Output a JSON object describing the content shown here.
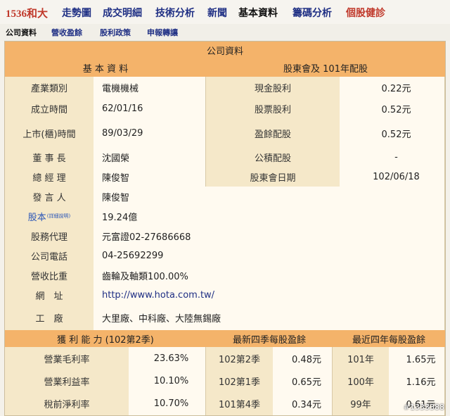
{
  "top_nav": {
    "stock_label": "1536和大",
    "items": [
      {
        "label": "走勢圖",
        "current": false,
        "color": "#1f2f84"
      },
      {
        "label": "成交明細",
        "current": false,
        "color": "#1f2f84"
      },
      {
        "label": "技術分析",
        "current": false,
        "color": "#1f2f84"
      },
      {
        "label": "新聞",
        "current": false,
        "color": "#1f2f84"
      },
      {
        "label": "基本資料",
        "current": true,
        "color": "#111111"
      },
      {
        "label": "籌碼分析",
        "current": false,
        "color": "#1f2f84"
      },
      {
        "label": "個股健診",
        "current": false,
        "color": "#c0392b"
      }
    ]
  },
  "sub_nav": {
    "items": [
      {
        "label": "公司資料",
        "current": true
      },
      {
        "label": "營收盈餘",
        "current": false
      },
      {
        "label": "股利政策",
        "current": false
      },
      {
        "label": "申報轉讓",
        "current": false
      }
    ]
  },
  "company": {
    "title": "公司資料",
    "left_header": "基 本 資 料",
    "right_header": "股東會及 101年配股",
    "rows": [
      {
        "label": "產業類別",
        "value": "電機機械",
        "right_label": "現金股利",
        "right_value": "0.22元"
      },
      {
        "label": "成立時間",
        "value": "62/01/16",
        "right_label": "股票股利",
        "right_value": "0.52元"
      },
      {
        "label": "上市(櫃)時間",
        "value": "89/03/29",
        "right_label": "盈餘配股",
        "right_value": "0.52元"
      },
      {
        "label": "董 事 長",
        "value": "沈國榮",
        "right_label": "公積配股",
        "right_value": "-"
      },
      {
        "label": "總 經 理",
        "value": "陳俊智",
        "right_label": "股東會日期",
        "right_value": "102/06/18"
      },
      {
        "label": "發 言 人",
        "value": "陳俊智"
      },
      {
        "label": "股本",
        "label_suffix": "(詳細說明)",
        "value": "19.24億"
      },
      {
        "label": "股務代理",
        "value": "元富證02-27686668"
      },
      {
        "label": "公司電話",
        "value": "04-25692299"
      },
      {
        "label": "營收比重",
        "value": "齒輪及軸類100.00%"
      },
      {
        "label": "網　址",
        "value": "http://www.hota.com.tw/"
      },
      {
        "label": "工　廠",
        "value": "大里廠、中科廠、大陸無錫廠"
      }
    ]
  },
  "bottom": {
    "headers": [
      "獲 利 能 力 (102第2季)",
      "最新四季每股盈餘",
      "最近四年每股盈餘"
    ],
    "rows": [
      {
        "metric": "營業毛利率",
        "metric_value": "23.63%",
        "q_label": "102第2季",
        "q_value": "0.48元",
        "y_label": "101年",
        "y_value": "1.65元"
      },
      {
        "metric": "營業利益率",
        "metric_value": "10.10%",
        "q_label": "102第1季",
        "q_value": "0.65元",
        "y_label": "100年",
        "y_value": "1.16元"
      },
      {
        "metric": "稅前淨利率",
        "metric_value": "10.70%",
        "q_label": "101第4季",
        "q_value": "0.34元",
        "y_label": "99年",
        "y_value": "0.61元"
      }
    ]
  },
  "watermark": "#1333388"
}
